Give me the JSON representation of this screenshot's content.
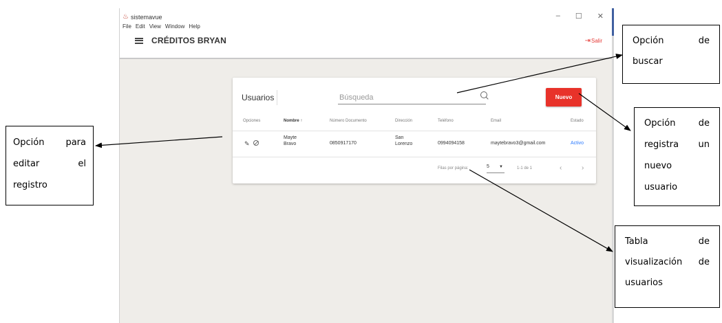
{
  "window": {
    "app_name": "sistemavue",
    "controls": [
      "–",
      "☐",
      "✕"
    ],
    "menu": [
      "File",
      "Edit",
      "View",
      "Window",
      "Help"
    ],
    "toolbar_title": "CRÉDITOS BRYAN",
    "logout_label": "Salir"
  },
  "card": {
    "title": "Usuarios",
    "search_placeholder": "Búsqueda",
    "new_button_label": "Nuevo",
    "columns": [
      "Opciones",
      "Nombre ↑",
      "Número Documento",
      "Dirección",
      "Teléfono",
      "Email",
      "Estado"
    ],
    "row": {
      "name_line1": "Mayte",
      "name_line2": "Bravo",
      "document": "0850917170",
      "address_line1": "San",
      "address_line2": "Lorenzo",
      "phone": "0994094158",
      "email": "maytebravo3@gmail.com",
      "status": "Activo"
    },
    "footer": {
      "rows_per_page_label": "Filas por página:",
      "rows_per_page_value": "5",
      "range": "1-1 de 1",
      "prev": "‹",
      "next": "›"
    }
  },
  "annotations": {
    "edit": [
      "Opción para",
      "editar el",
      "registro"
    ],
    "search": [
      "Opción de",
      "buscar"
    ],
    "new": [
      "Opción de",
      "registra un",
      "nuevo",
      "usuario"
    ],
    "table": [
      "Tabla de",
      "visualización de",
      "usuarios"
    ]
  },
  "colors": {
    "accent_red": "#e8322a",
    "status_blue": "#2979ff",
    "window_accent": "#3f5fa0",
    "background": "#efede9"
  }
}
